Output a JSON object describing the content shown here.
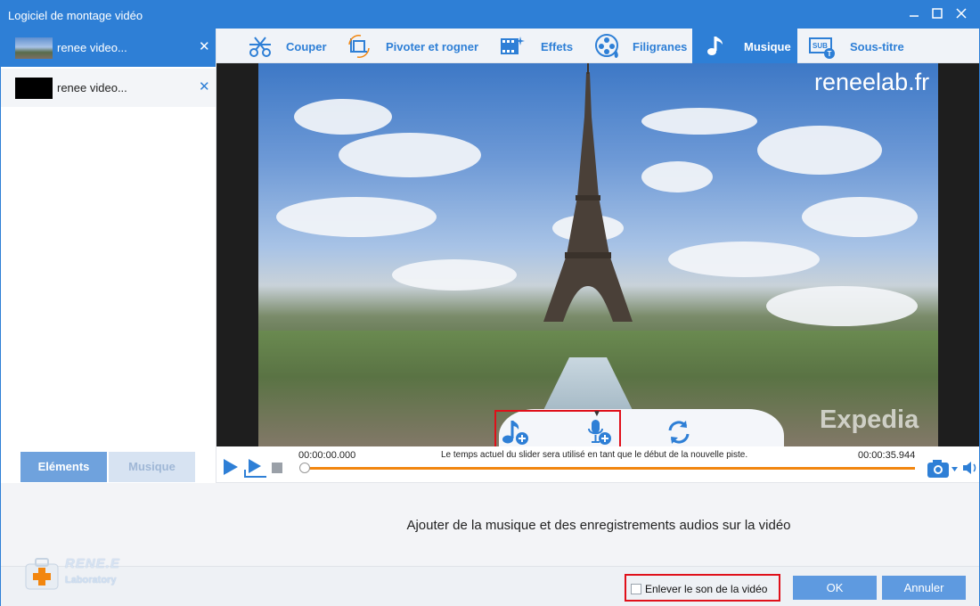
{
  "window": {
    "title": "Logiciel de montage vidéo",
    "minimize_icon": "minimize-icon",
    "maximize_icon": "maximize-icon",
    "close_icon": "close-icon"
  },
  "files": [
    {
      "name": "renee video...",
      "close": "✕",
      "active": true
    },
    {
      "name": "renee video...",
      "close": "✕",
      "active": false
    }
  ],
  "left_tabs": {
    "elements": "Eléments",
    "music": "Musique"
  },
  "toolbar": {
    "tabs": [
      {
        "label": "Couper",
        "icon": "cut-icon"
      },
      {
        "label": "Pivoter et rogner",
        "icon": "rotate-crop-icon"
      },
      {
        "label": "Effets",
        "icon": "effects-icon"
      },
      {
        "label": "Filigranes",
        "icon": "watermark-icon"
      },
      {
        "label": "Musique",
        "icon": "music-note-icon",
        "active": true
      },
      {
        "label": "Sous-titre",
        "icon": "subtitle-icon"
      }
    ]
  },
  "preview": {
    "watermark": "reneelab.fr",
    "overlay_logo": "Expedia",
    "music_actions": [
      "add-music-icon",
      "add-recording-icon",
      "replace-audio-icon"
    ]
  },
  "timeline": {
    "current_time": "00:00:00.000",
    "total_time": "00:00:35.944",
    "hint": "Le temps actuel du slider sera utilisé en tant que le début de la nouvelle piste.",
    "progress": 0
  },
  "status_text": "Ajouter de la musique et des enregistrements audios sur la vidéo",
  "logo": {
    "line1": "RENE.E",
    "line2": "Laboratory"
  },
  "mute_checkbox": {
    "label": "Enlever le son de la vidéo",
    "checked": false
  },
  "buttons": {
    "ok": "OK",
    "cancel": "Annuler"
  },
  "colors": {
    "accent": "#2e7fd6",
    "highlight": "#e0101a",
    "timeline": "#f2860f",
    "button": "#5e9ae0"
  }
}
